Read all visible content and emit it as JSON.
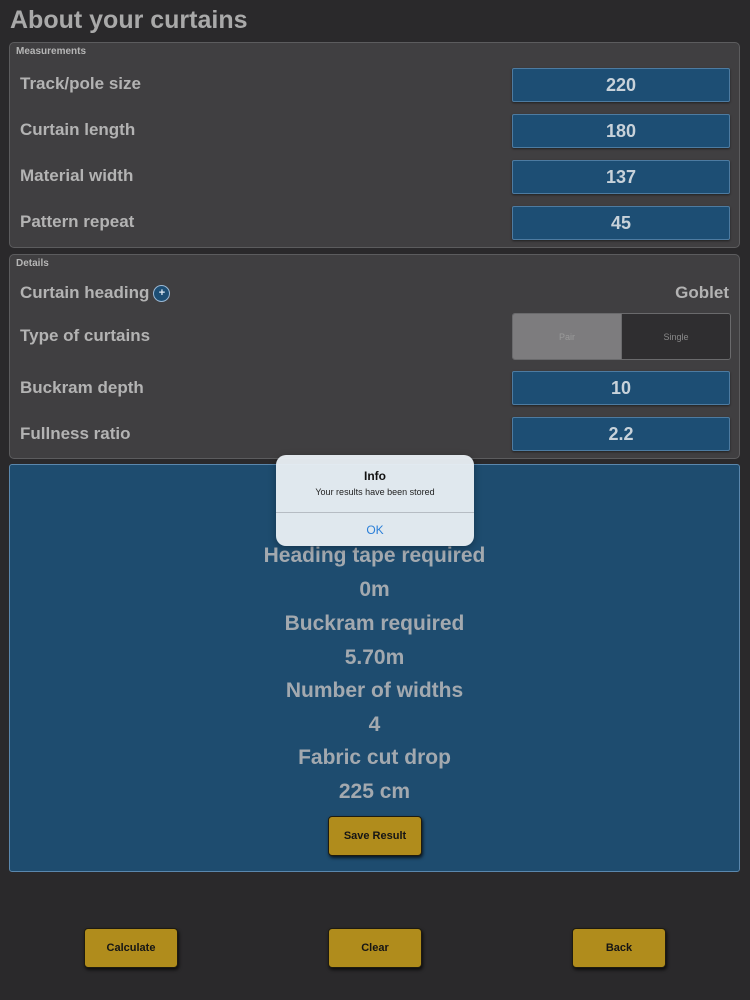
{
  "page": {
    "title": "About your curtains"
  },
  "measurements": {
    "caption": "Measurements",
    "rows": [
      {
        "label": "Track/pole size",
        "value": "220"
      },
      {
        "label": "Curtain length",
        "value": "180"
      },
      {
        "label": "Material width",
        "value": "137"
      },
      {
        "label": "Pattern repeat",
        "value": "45"
      }
    ]
  },
  "details": {
    "caption": "Details",
    "heading": {
      "label": "Curtain heading",
      "value": "Goblet",
      "icon": "plus-info-icon"
    },
    "type": {
      "label": "Type of curtains",
      "options": [
        "Pair",
        "Single"
      ],
      "selected": "Pair"
    },
    "buckram": {
      "label": "Buckram depth",
      "value": "10"
    },
    "fullness": {
      "label": "Fullness ratio",
      "value": "2.2"
    }
  },
  "results": {
    "heading_tape_label": "Heading tape required",
    "heading_tape_value": "0m",
    "buckram_label": "Buckram required",
    "buckram_value": "5.70m",
    "widths_label": "Number of widths",
    "widths_value": "4",
    "drop_label": "Fabric cut drop",
    "drop_value": "225 cm",
    "save_label": "Save Result"
  },
  "alert": {
    "title": "Info",
    "message": "Your results have been stored",
    "ok_label": "OK"
  },
  "toolbar": {
    "calculate_label": "Calculate",
    "clear_label": "Clear",
    "back_label": "Back"
  },
  "colors": {
    "background": "#2a292b",
    "panel": "#403f41",
    "input_blue": "#1d4e74",
    "button_gold": "#b08c1c",
    "alert_link": "#2b7fd8"
  }
}
